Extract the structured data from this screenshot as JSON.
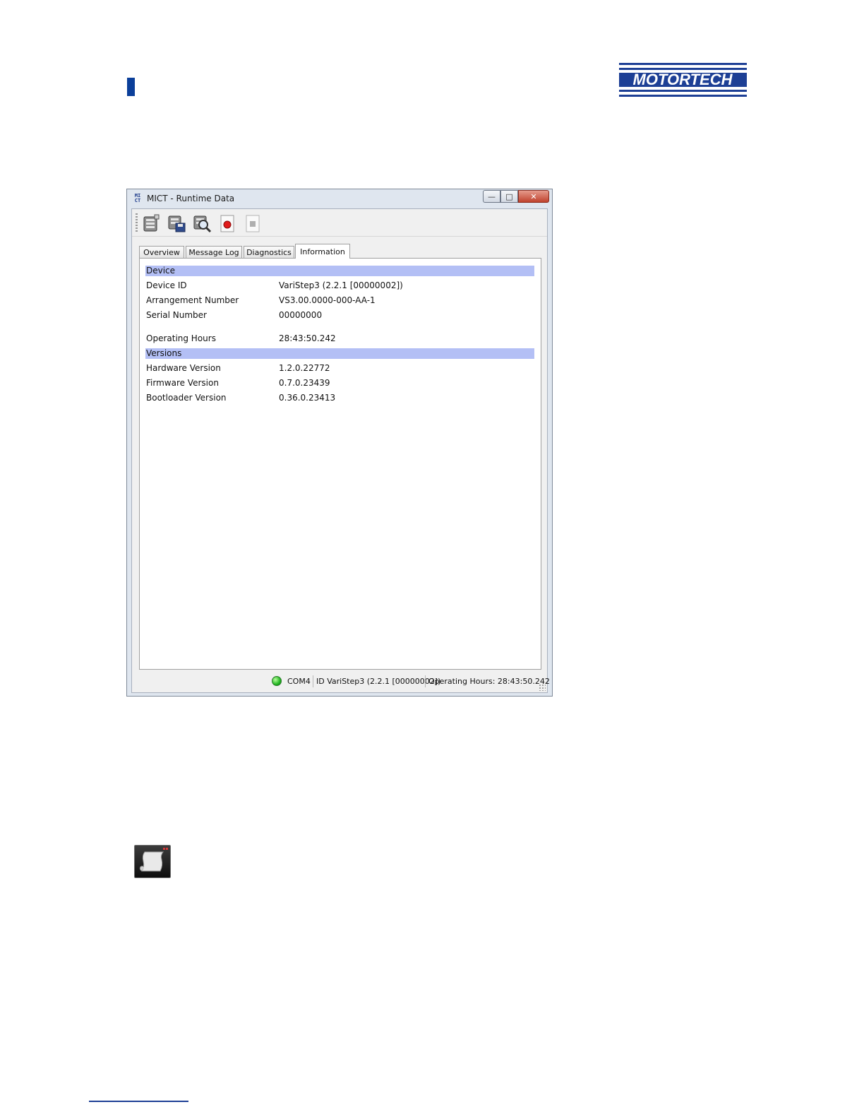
{
  "brand": {
    "logo_text": "MOTORTECH",
    "color": "#1d3f95"
  },
  "window": {
    "app_icon": "MI CT",
    "title": "MICT - Runtime Data",
    "controls": {
      "minimize": "—",
      "maximize": "□",
      "close": "✕"
    }
  },
  "toolbar": {
    "icons": [
      "runtime-data-icon",
      "save-data-icon",
      "search-data-icon",
      "record-icon",
      "stop-icon"
    ]
  },
  "tabs": [
    {
      "label": "Overview"
    },
    {
      "label": "Message Log"
    },
    {
      "label": "Diagnostics"
    },
    {
      "label": "Information",
      "active": true
    }
  ],
  "info": {
    "device": {
      "header": "Device",
      "rows": [
        {
          "label": "Device ID",
          "value": "VariStep3 (2.2.1 [00000002])"
        },
        {
          "label": "Arrangement Number",
          "value": "VS3.00.0000-000-AA-1"
        },
        {
          "label": "Serial Number",
          "value": "00000000"
        },
        {
          "label": "Operating Hours",
          "value": "28:43:50.242"
        }
      ]
    },
    "versions": {
      "header": "Versions",
      "rows": [
        {
          "label": "Hardware Version",
          "value": "1.2.0.22772"
        },
        {
          "label": "Firmware Version",
          "value": "0.7.0.23439"
        },
        {
          "label": "Bootloader Version",
          "value": "0.36.0.23413"
        }
      ]
    }
  },
  "status": {
    "port": "COM4",
    "device": "ID VariStep3 (2.2.1 [00000002])",
    "hours": "Operating Hours: 28:43:50.242",
    "led_color": "#22b522"
  }
}
